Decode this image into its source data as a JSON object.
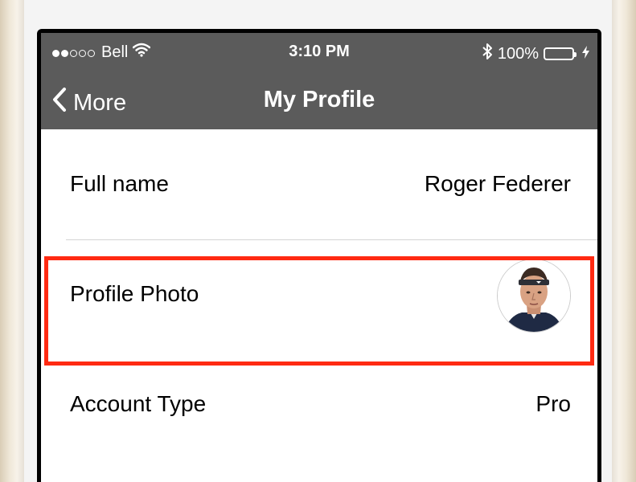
{
  "status_bar": {
    "carrier": "Bell",
    "time": "3:10 PM",
    "battery": "100%",
    "signal_dots": [
      true,
      true,
      false,
      false,
      false
    ]
  },
  "nav": {
    "back_label": "More",
    "title": "My Profile"
  },
  "rows": [
    {
      "label": "Full name",
      "value": "Roger Federer"
    },
    {
      "label": "Profile Photo"
    },
    {
      "label": "Account Type",
      "value": "Pro"
    }
  ],
  "colors": {
    "nav_background": "#5b5b5b",
    "highlight_border": "#ff2a12",
    "battery_fill": "#5fe05f"
  }
}
